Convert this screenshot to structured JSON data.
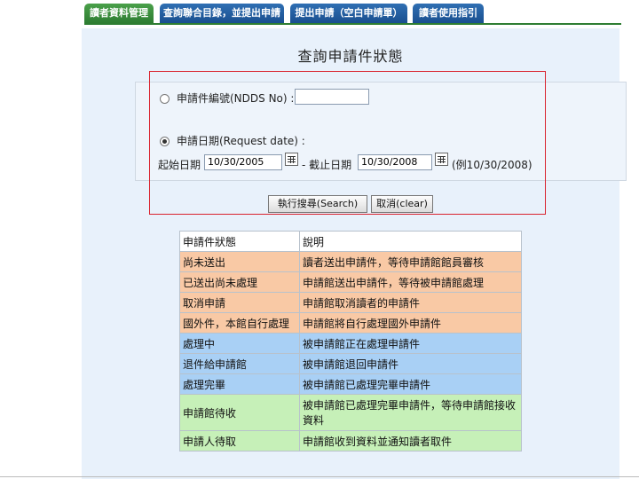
{
  "tabs": [
    {
      "label": "讀者資料管理",
      "active": true
    },
    {
      "label": "查詢聯合目錄，並提出申請",
      "active": false
    },
    {
      "label": "提出申請（空白申請單）",
      "active": false
    },
    {
      "label": "讀者使用指引",
      "active": false
    }
  ],
  "page_title": "查詢申請件狀態",
  "form": {
    "ndds_label": "申請件編號(NDDS No) :",
    "ndds_value": "",
    "request_date_label": "申請日期(Request date) :",
    "start_label": "起始日期",
    "start_value": "10/30/2005",
    "end_label": "- 截止日期",
    "end_value": "10/30/2008",
    "example": "(例10/30/2008)",
    "search_button": "執行搜尋(Search)",
    "clear_button": "取消(clear)"
  },
  "colors": {
    "orange": "#f9c9a5",
    "blue": "#a9d0f5",
    "green": "#c6f0b8",
    "header": "#ffffff",
    "highlight_border": "#d9232e"
  },
  "status_table": {
    "headers": [
      "申請件狀態",
      "說明"
    ],
    "rows": [
      {
        "status": "尚未送出",
        "desc": "讀者送出申請件，等待申請館館員審核",
        "color": "orange"
      },
      {
        "status": "已送出尚未處理",
        "desc": "申請館送出申請件，等待被申請館處理",
        "color": "orange"
      },
      {
        "status": "取消申請",
        "desc": "申請館取消讀者的申請件",
        "color": "orange"
      },
      {
        "status": "國外件，本館自行處理",
        "desc": "申請館將自行處理國外申請件",
        "color": "orange"
      },
      {
        "status": "處理中",
        "desc": "被申請館正在處理申請件",
        "color": "blue"
      },
      {
        "status": "退件給申請館",
        "desc": "被申請館退回申請件",
        "color": "blue"
      },
      {
        "status": "處理完畢",
        "desc": "被申請館已處理完畢申請件",
        "color": "blue"
      },
      {
        "status": "申請館待收",
        "desc": "被申請館已處理完畢申請件，等待申請館接收資料",
        "color": "green"
      },
      {
        "status": "申請人待取",
        "desc": "申請館收到資料並通知讀者取件",
        "color": "green"
      }
    ]
  }
}
